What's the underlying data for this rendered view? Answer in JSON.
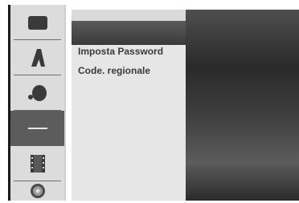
{
  "sidebar": {
    "items": [
      {
        "icon": "disc-menu-icon",
        "active": false
      },
      {
        "icon": "language-icon",
        "active": false
      },
      {
        "icon": "audio-icon",
        "active": false
      },
      {
        "icon": "lock-setup-icon",
        "active": true
      },
      {
        "icon": "film-icon",
        "active": false
      },
      {
        "icon": "dvd-disc-icon",
        "active": false
      }
    ]
  },
  "submenu": {
    "items": [
      {
        "label": "Imposta Password"
      },
      {
        "label": "Code. regionale"
      }
    ]
  },
  "colors": {
    "rail_background": "#dcdcdc",
    "active_item": "#5c5c5c",
    "submenu_background": "#e6e6e6",
    "content_dark": "#2a2a2a"
  }
}
